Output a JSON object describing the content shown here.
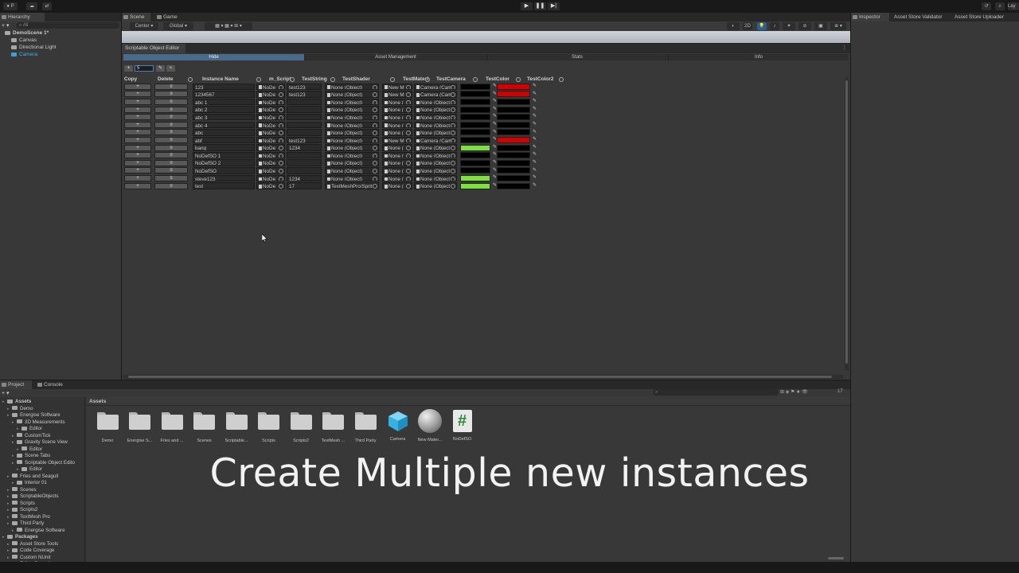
{
  "top_toolbar": {
    "left_labels": [
      "P",
      "▾"
    ],
    "right_labels": [
      "Lay"
    ]
  },
  "hierarchy": {
    "tab_label": "Hierarchy",
    "search_placeholder": "All",
    "items": [
      {
        "label": "DemoScene 1*",
        "depth": 0
      },
      {
        "label": "Canvas",
        "depth": 1
      },
      {
        "label": "Directional Light",
        "depth": 1
      },
      {
        "label": "Camera",
        "depth": 1
      }
    ]
  },
  "scene_tabs": [
    "Scene",
    "Game"
  ],
  "scene_toolbar": {
    "pivot": "Center",
    "space": "Global",
    "mode_2d": "2D"
  },
  "sce_window": {
    "title": "Scriptable Object Editor",
    "tabs": [
      "Hide",
      "Asset Management",
      "Stats",
      "Info"
    ],
    "toolbar": {
      "add_label": "+",
      "count_value": "5",
      "extra_labels": [
        "✎",
        "×"
      ]
    },
    "columns": [
      {
        "label": "Copy",
        "search": false
      },
      {
        "label": "Delete",
        "search": true
      },
      {
        "label": "Instance Name",
        "search": true
      },
      {
        "label": "m_Script",
        "search": true
      },
      {
        "label": "TestString",
        "search": true
      },
      {
        "label": "TestShader",
        "search": true
      },
      {
        "label": "TestMateri",
        "search": true
      },
      {
        "label": "TestCamera",
        "search": true
      },
      {
        "label": "TestColor",
        "search": true
      },
      {
        "label": "TestColor2",
        "search": true
      }
    ],
    "copy_label": "+",
    "delete_label": "≡",
    "rows": [
      {
        "name": "123",
        "script": "NoDe",
        "string": "test123",
        "shader": "None (Object)",
        "mat": "New M",
        "cam": "Camera (Cam",
        "c1": "#000000",
        "c2": "#d40000"
      },
      {
        "name": "1234567",
        "script": "NoDe",
        "string": "test123",
        "shader": "None (Object)",
        "mat": "New M",
        "cam": "Camera (Cam",
        "c1": "#000000",
        "c2": "#d40000"
      },
      {
        "name": "abc 1",
        "script": "NoDe",
        "string": "",
        "shader": "None (Object)",
        "mat": "None (",
        "cam": "None (Object",
        "c1": "#000000",
        "c2": "#000000"
      },
      {
        "name": "abc 2",
        "script": "NoDe",
        "string": "",
        "shader": "None (Object)",
        "mat": "None (",
        "cam": "None (Object",
        "c1": "#000000",
        "c2": "#000000"
      },
      {
        "name": "abc 3",
        "script": "NoDe",
        "string": "",
        "shader": "None (Object)",
        "mat": "None (",
        "cam": "None (Object",
        "c1": "#000000",
        "c2": "#000000"
      },
      {
        "name": "abc 4",
        "script": "NoDe",
        "string": "",
        "shader": "None (Object)",
        "mat": "None (",
        "cam": "None (Object",
        "c1": "#000000",
        "c2": "#000000"
      },
      {
        "name": "abc",
        "script": "NoDe",
        "string": "",
        "shader": "None (Object)",
        "mat": "None (",
        "cam": "None (Object",
        "c1": "#000000",
        "c2": "#000000"
      },
      {
        "name": "abf",
        "script": "NoDe",
        "string": "test123",
        "shader": "None (Object)",
        "mat": "New M",
        "cam": "Camera (Cam",
        "c1": "#000000",
        "c2": "#d40000"
      },
      {
        "name": "bang",
        "script": "NoDe",
        "string": "1234",
        "shader": "None (Object)",
        "mat": "None (",
        "cam": "None (Object",
        "c1": "#7ee03a",
        "c2": "#000000"
      },
      {
        "name": "NoDefSO 1",
        "script": "NoDe",
        "string": "",
        "shader": "None (Object)",
        "mat": "None (",
        "cam": "None (Object",
        "c1": "#000000",
        "c2": "#000000"
      },
      {
        "name": "NoDefSO 2",
        "script": "NoDe",
        "string": "",
        "shader": "None (Object)",
        "mat": "None (",
        "cam": "None (Object",
        "c1": "#000000",
        "c2": "#000000"
      },
      {
        "name": "NoDefSO",
        "script": "NoDe",
        "string": "",
        "shader": "None (Object)",
        "mat": "None (",
        "cam": "None (Object",
        "c1": "#000000",
        "c2": "#000000"
      },
      {
        "name": "steve123",
        "script": "NoDe",
        "string": "1234",
        "shader": "None (Object)",
        "mat": "None (",
        "cam": "None (Object",
        "c1": "#7ee03a",
        "c2": "#000000"
      },
      {
        "name": "test",
        "script": "NoDe",
        "string": "17",
        "shader": "TextMeshPro/Sprit",
        "mat": "None (",
        "cam": "None (Object",
        "c1": "#7ee03a",
        "c2": "#000000"
      }
    ]
  },
  "inspector_tabs": [
    "Inspector",
    "Asset Store Validator",
    "Asset Store Uploader"
  ],
  "project": {
    "tabs": [
      "Project",
      "Console"
    ],
    "breadcrumb": "Assets",
    "hidden_count": "17",
    "tree": [
      {
        "label": "Assets",
        "depth": 0,
        "bold": true
      },
      {
        "label": "Demo",
        "depth": 1
      },
      {
        "label": "Energise Software",
        "depth": 1
      },
      {
        "label": "3D Measurements",
        "depth": 2
      },
      {
        "label": "Editor",
        "depth": 3
      },
      {
        "label": "CustomTick",
        "depth": 2
      },
      {
        "label": "Gravity Scene View",
        "depth": 2
      },
      {
        "label": "Editor",
        "depth": 3
      },
      {
        "label": "Scene Tabs",
        "depth": 2
      },
      {
        "label": "Scriptable Object Edito",
        "depth": 2
      },
      {
        "label": "Editor",
        "depth": 3
      },
      {
        "label": "Fries and Seagull",
        "depth": 1
      },
      {
        "label": "Interior 01",
        "depth": 2
      },
      {
        "label": "Scenes",
        "depth": 1
      },
      {
        "label": "ScriptableObjects",
        "depth": 1
      },
      {
        "label": "Scripts",
        "depth": 1
      },
      {
        "label": "Scripts2",
        "depth": 1
      },
      {
        "label": "TextMesh Pro",
        "depth": 1
      },
      {
        "label": "Third Party",
        "depth": 1
      },
      {
        "label": "Energise Software",
        "depth": 2
      },
      {
        "label": "Packages",
        "depth": 0,
        "bold": true
      },
      {
        "label": "Asset Store Tools",
        "depth": 1
      },
      {
        "label": "Code Coverage",
        "depth": 1
      },
      {
        "label": "Custom NUnit",
        "depth": 1
      },
      {
        "label": "Editor Coroutines",
        "depth": 1
      }
    ],
    "assets": [
      {
        "label": "Demo",
        "kind": "folder"
      },
      {
        "label": "Energise S...",
        "kind": "folder"
      },
      {
        "label": "Fries and ...",
        "kind": "folder"
      },
      {
        "label": "Scenes",
        "kind": "folder"
      },
      {
        "label": "Scriptable...",
        "kind": "folder"
      },
      {
        "label": "Scripts",
        "kind": "folder"
      },
      {
        "label": "Scripts2",
        "kind": "folder"
      },
      {
        "label": "TextMesh ...",
        "kind": "folder"
      },
      {
        "label": "Third Party",
        "kind": "folder"
      },
      {
        "label": "Camera",
        "kind": "prefab"
      },
      {
        "label": "New Mater...",
        "kind": "material"
      },
      {
        "label": "NoDefSO",
        "kind": "script",
        "glyph": "#"
      }
    ]
  },
  "caption": "Create Multiple new instances",
  "colors": {
    "red": "#d40000",
    "green": "#7ee03a",
    "accent_blue": "#3a79bb"
  }
}
